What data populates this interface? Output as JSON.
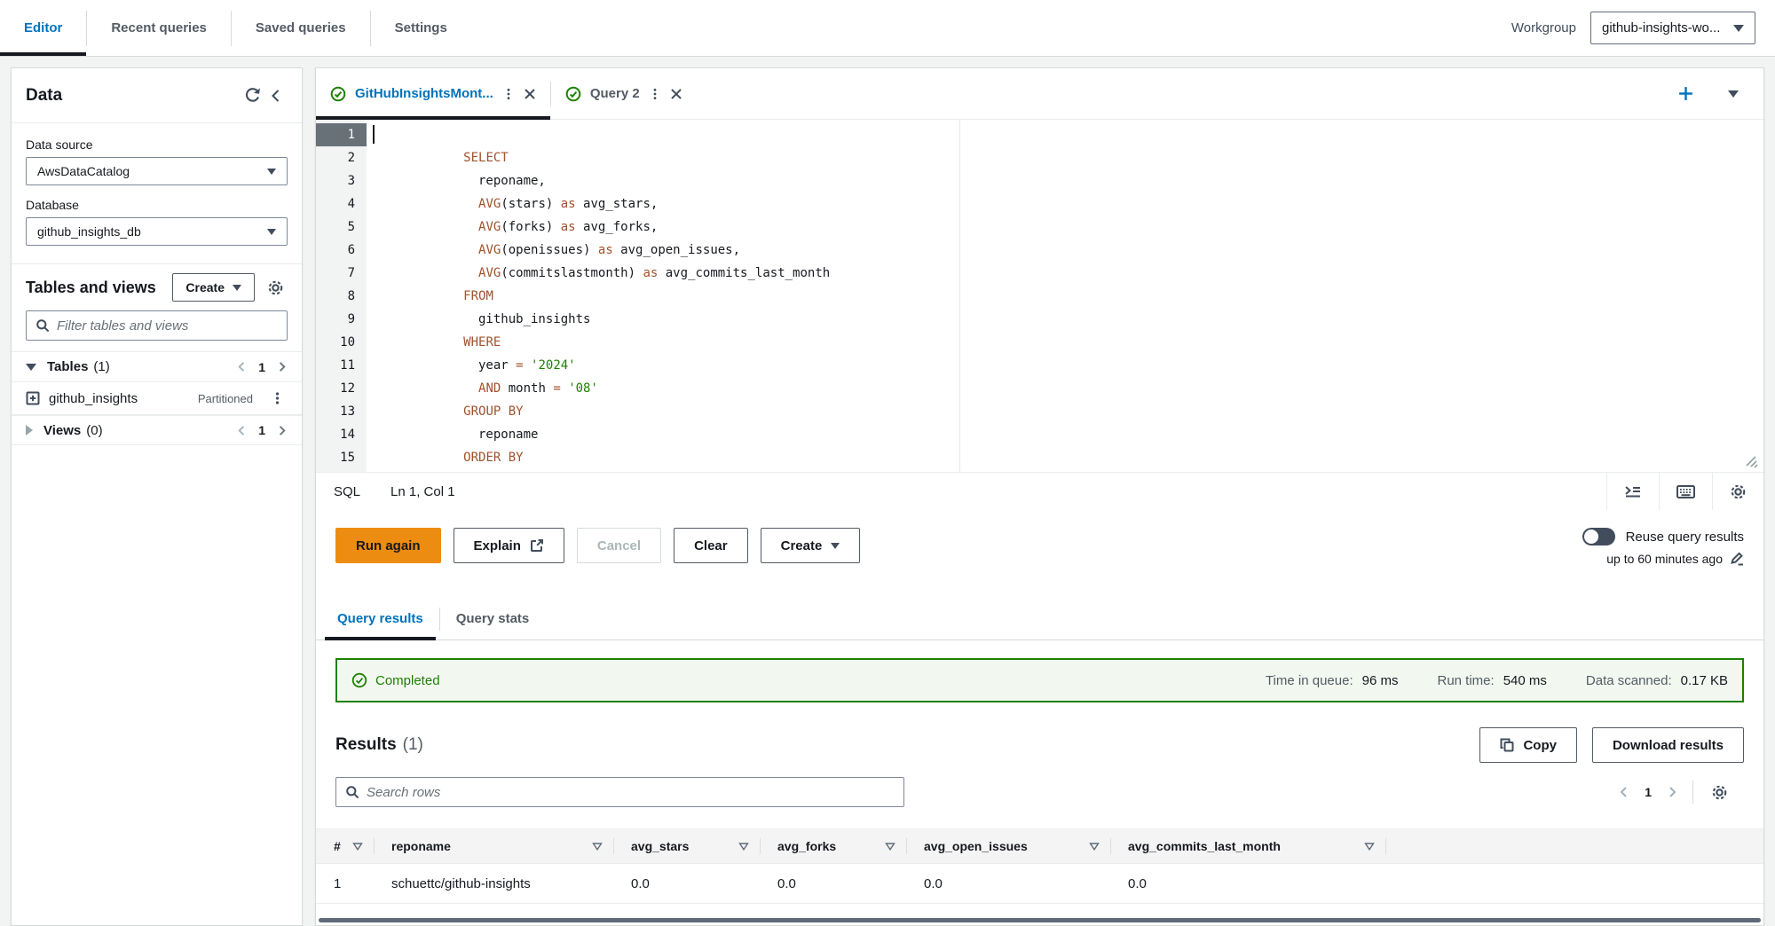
{
  "topnav": {
    "tabs": [
      {
        "label": "Editor",
        "active": true
      },
      {
        "label": "Recent queries",
        "active": false
      },
      {
        "label": "Saved queries",
        "active": false
      },
      {
        "label": "Settings",
        "active": false
      }
    ],
    "workgroup_label": "Workgroup",
    "workgroup_value": "github-insights-wo..."
  },
  "sidebar": {
    "title": "Data",
    "data_source_label": "Data source",
    "data_source_value": "AwsDataCatalog",
    "database_label": "Database",
    "database_value": "github_insights_db",
    "tables_views_title": "Tables and views",
    "create_label": "Create",
    "filter_placeholder": "Filter tables and views",
    "tables_section": {
      "label": "Tables",
      "count": "(1)",
      "page": "1"
    },
    "table_item": {
      "name": "github_insights",
      "badge": "Partitioned"
    },
    "views_section": {
      "label": "Views",
      "count": "(0)",
      "page": "1"
    }
  },
  "editor": {
    "tabs": [
      {
        "label": "GitHubInsightsMont...",
        "active": true
      },
      {
        "label": "Query 2",
        "active": false
      }
    ],
    "status": {
      "lang": "SQL",
      "position": "Ln 1, Col 1"
    },
    "code_lines": [
      {
        "n": "1",
        "active": true,
        "tokens": []
      },
      {
        "n": "2",
        "tokens": [
          {
            "t": "pl",
            "v": "            "
          },
          {
            "t": "kw",
            "v": "SELECT"
          }
        ]
      },
      {
        "n": "3",
        "tokens": [
          {
            "t": "pl",
            "v": "              reponame,"
          }
        ]
      },
      {
        "n": "4",
        "tokens": [
          {
            "t": "pl",
            "v": "              "
          },
          {
            "t": "kw",
            "v": "AVG"
          },
          {
            "t": "pl",
            "v": "(stars) "
          },
          {
            "t": "kw",
            "v": "as"
          },
          {
            "t": "pl",
            "v": " avg_stars,"
          }
        ]
      },
      {
        "n": "5",
        "tokens": [
          {
            "t": "pl",
            "v": "              "
          },
          {
            "t": "kw",
            "v": "AVG"
          },
          {
            "t": "pl",
            "v": "(forks) "
          },
          {
            "t": "kw",
            "v": "as"
          },
          {
            "t": "pl",
            "v": " avg_forks,"
          }
        ]
      },
      {
        "n": "6",
        "tokens": [
          {
            "t": "pl",
            "v": "              "
          },
          {
            "t": "kw",
            "v": "AVG"
          },
          {
            "t": "pl",
            "v": "(openissues) "
          },
          {
            "t": "kw",
            "v": "as"
          },
          {
            "t": "pl",
            "v": " avg_open_issues,"
          }
        ]
      },
      {
        "n": "7",
        "tokens": [
          {
            "t": "pl",
            "v": "              "
          },
          {
            "t": "kw",
            "v": "AVG"
          },
          {
            "t": "pl",
            "v": "(commitslastmonth) "
          },
          {
            "t": "kw",
            "v": "as"
          },
          {
            "t": "pl",
            "v": " avg_commits_last_month"
          }
        ]
      },
      {
        "n": "8",
        "tokens": [
          {
            "t": "pl",
            "v": "            "
          },
          {
            "t": "kw",
            "v": "FROM"
          }
        ]
      },
      {
        "n": "9",
        "tokens": [
          {
            "t": "pl",
            "v": "              github_insights"
          }
        ]
      },
      {
        "n": "10",
        "tokens": [
          {
            "t": "pl",
            "v": "            "
          },
          {
            "t": "kw",
            "v": "WHERE"
          }
        ]
      },
      {
        "n": "11",
        "tokens": [
          {
            "t": "pl",
            "v": "              year "
          },
          {
            "t": "op",
            "v": "="
          },
          {
            "t": "pl",
            "v": " "
          },
          {
            "t": "str",
            "v": "'2024'"
          }
        ]
      },
      {
        "n": "12",
        "tokens": [
          {
            "t": "pl",
            "v": "              "
          },
          {
            "t": "kw",
            "v": "AND"
          },
          {
            "t": "pl",
            "v": " month "
          },
          {
            "t": "op",
            "v": "="
          },
          {
            "t": "pl",
            "v": " "
          },
          {
            "t": "str",
            "v": "'08'"
          }
        ]
      },
      {
        "n": "13",
        "tokens": [
          {
            "t": "pl",
            "v": "            "
          },
          {
            "t": "kw",
            "v": "GROUP BY"
          }
        ]
      },
      {
        "n": "14",
        "tokens": [
          {
            "t": "pl",
            "v": "              reponame"
          }
        ]
      },
      {
        "n": "15",
        "tokens": [
          {
            "t": "pl",
            "v": "            "
          },
          {
            "t": "kw",
            "v": "ORDER BY"
          }
        ]
      }
    ]
  },
  "actions": {
    "run_label": "Run again",
    "explain_label": "Explain",
    "cancel_label": "Cancel",
    "clear_label": "Clear",
    "create_label": "Create",
    "reuse_label": "Reuse query results",
    "reuse_sub": "up to 60 minutes ago"
  },
  "results": {
    "tabs": [
      {
        "label": "Query results",
        "active": true
      },
      {
        "label": "Query stats",
        "active": false
      }
    ],
    "banner": {
      "status": "Completed",
      "stats": [
        {
          "label": "Time in queue:",
          "value": "96 ms"
        },
        {
          "label": "Run time:",
          "value": "540 ms"
        },
        {
          "label": "Data scanned:",
          "value": "0.17 KB"
        }
      ]
    },
    "title": "Results",
    "count": "(1)",
    "copy_label": "Copy",
    "download_label": "Download results",
    "search_placeholder": "Search rows",
    "page": "1",
    "table": {
      "columns": [
        "#",
        "reponame",
        "avg_stars",
        "avg_forks",
        "avg_open_issues",
        "avg_commits_last_month"
      ],
      "rows": [
        [
          "1",
          "schuettc/github-insights",
          "0.0",
          "0.0",
          "0.0",
          "0.0"
        ]
      ]
    }
  },
  "colors": {
    "accent_blue": "#0073bb",
    "success_green": "#1d8102",
    "run_button_orange": "#ec8c10",
    "code_keyword": "#a0522d",
    "code_string": "#1d8102"
  }
}
